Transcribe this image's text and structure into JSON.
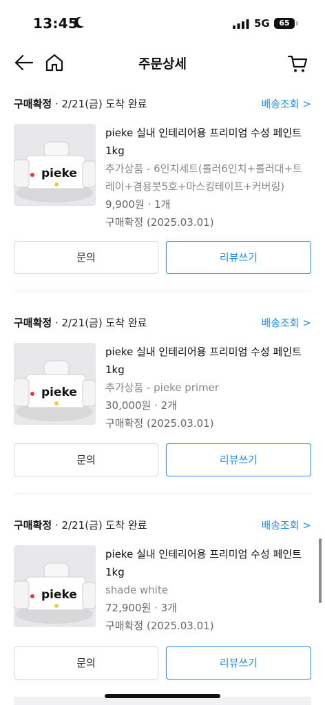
{
  "status_bar": {
    "time": "13:45",
    "network": "5G",
    "battery": "65"
  },
  "header": {
    "title": "주문상세"
  },
  "orders": [
    {
      "status": "구매확정",
      "date_text": "2/21(금) 도착 완료",
      "track_label": "배송조회 >",
      "product_name": "pieke 실내 인테리어용 프리미엄 수성 페인트 1kg",
      "option": "추가상품 - 6인치세트(롤러6인치+롤러대+트레이+겸용붓5호+마스킹테이프+커버링)",
      "price": "9,900원 · 1개",
      "confirm_text": "구매확정 (2025.03.01)",
      "inquiry_label": "문의",
      "review_label": "리뷰쓰기"
    },
    {
      "status": "구매확정",
      "date_text": "2/21(금) 도착 완료",
      "track_label": "배송조회 >",
      "product_name": "pieke 실내 인테리어용 프리미엄 수성 페인트 1kg",
      "option": "추가상품 - pieke primer",
      "price": "30,000원 · 2개",
      "confirm_text": "구매확정 (2025.03.01)",
      "inquiry_label": "문의",
      "review_label": "리뷰쓰기"
    },
    {
      "status": "구매확정",
      "date_text": "2/21(금) 도착 완료",
      "track_label": "배송조회 >",
      "product_name": "pieke 실내 인테리어용 프리미엄 수성 페인트 1kg",
      "option": "shade white",
      "price": "72,900원 · 3개",
      "confirm_text": "구매확정 (2025.03.01)",
      "inquiry_label": "문의",
      "review_label": "리뷰쓰기"
    }
  ],
  "product_image": {
    "brand_text": "pieke"
  },
  "icons": {
    "back": "arrow-left-icon",
    "home": "home-icon",
    "cart": "cart-icon",
    "moon": "moon-icon",
    "signal": "signal-icon"
  },
  "colors": {
    "accent": "#1f8de6",
    "text": "#111111",
    "muted": "#888888",
    "border": "#d6d6d6"
  }
}
